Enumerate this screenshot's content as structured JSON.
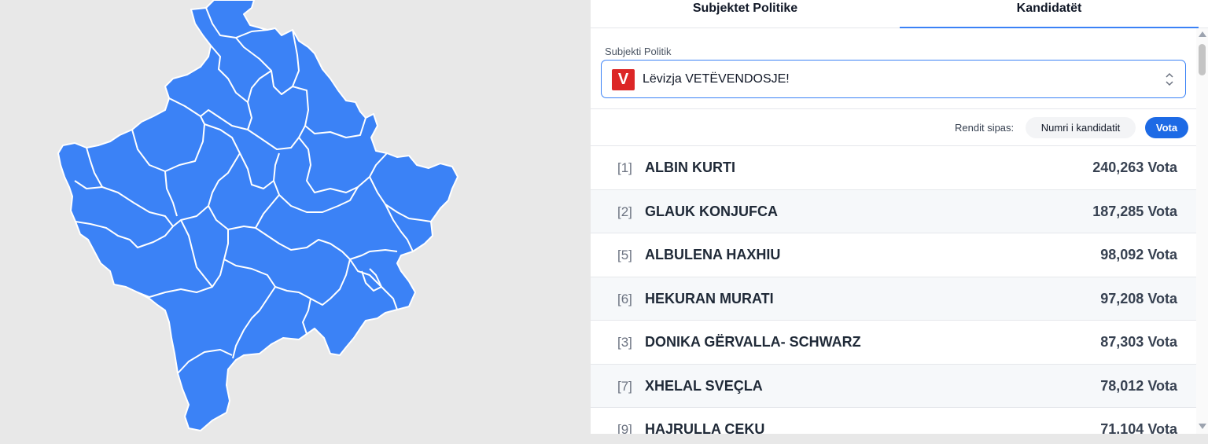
{
  "tabs": [
    {
      "label": "Subjektet Politike",
      "active": false
    },
    {
      "label": "Kandidatët",
      "active": true
    }
  ],
  "filter": {
    "label": "Subjekti Politik",
    "logo_letter": "V",
    "logo_color": "#dc2626",
    "selected": "Lëvizja VETËVENDOSJE!"
  },
  "sort": {
    "label": "Rendit sipas:",
    "option_number": "Numri i kandidatit",
    "option_votes": "Vota",
    "active": "Vota"
  },
  "candidates": [
    {
      "number": "[1]",
      "name": "ALBIN KURTI",
      "votes": "240,263 Vota"
    },
    {
      "number": "[2]",
      "name": "GLAUK KONJUFCA",
      "votes": "187,285 Vota"
    },
    {
      "number": "[5]",
      "name": "ALBULENA HAXHIU",
      "votes": "98,092 Vota"
    },
    {
      "number": "[6]",
      "name": "HEKURAN MURATI",
      "votes": "97,208 Vota"
    },
    {
      "number": "[3]",
      "name": "DONIKA GËRVALLA- SCHWARZ",
      "votes": "87,303 Vota"
    },
    {
      "number": "[7]",
      "name": "XHELAL SVEÇLA",
      "votes": "78,012 Vota"
    },
    {
      "number": "[9]",
      "name": "HAJRULLA ÇEKU",
      "votes": "71,104 Vota"
    }
  ],
  "colors": {
    "map_fill": "#3b82f6",
    "accent": "#1d6ae5"
  }
}
